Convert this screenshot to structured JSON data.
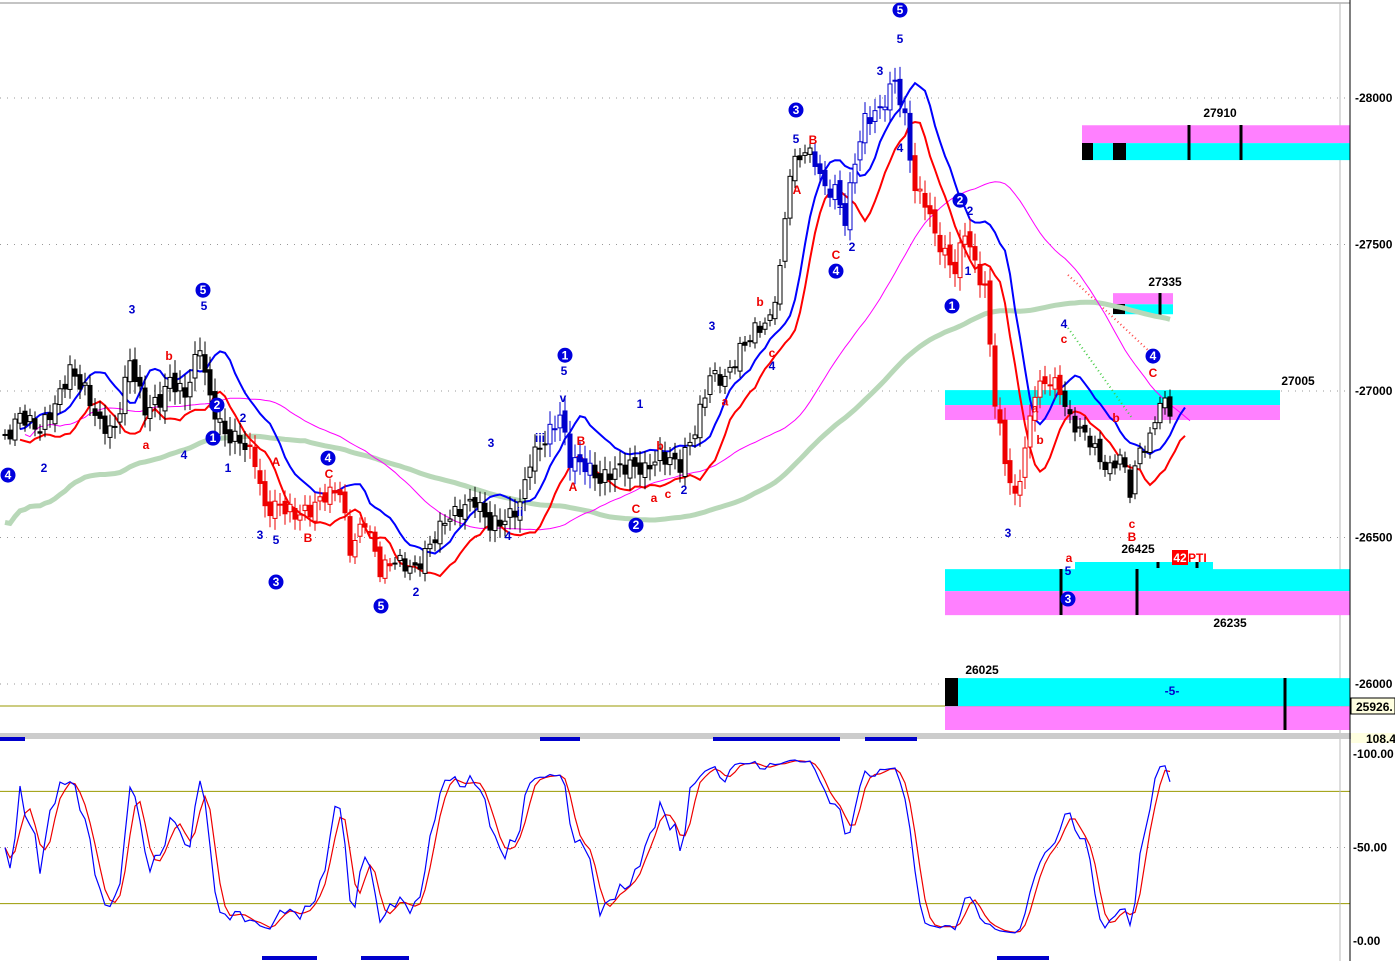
{
  "chart_data": {
    "type": "candlestick",
    "title": "",
    "instrument_note": "Elliott wave annotated price chart with stochastic oscillator",
    "price_axis": {
      "ylim": [
        25843,
        28334
      ],
      "ticks": [
        "28000",
        "27500",
        "27000",
        "26500",
        "26000"
      ],
      "current_tag": "25926."
    },
    "osc_axis": {
      "ylim": [
        0,
        100
      ],
      "ticks": [
        "108.4",
        "100.00",
        "50.00",
        "0.00"
      ],
      "levels": [
        80,
        20
      ]
    },
    "price_path": {
      "bar": [
        1,
        4,
        8,
        11,
        14,
        17,
        20,
        23,
        26,
        29,
        32,
        34,
        37,
        40,
        42,
        45,
        48,
        51,
        53,
        56,
        59,
        62,
        65,
        68,
        70,
        73,
        76,
        79,
        83,
        86,
        89,
        92,
        95,
        98,
        101,
        104,
        106,
        109,
        112,
        114,
        117,
        120,
        123,
        126,
        129,
        132,
        136,
        139,
        142,
        145,
        148,
        151,
        154,
        156,
        158,
        161,
        163,
        165,
        167,
        169,
        171,
        173,
        176,
        179,
        181,
        183,
        185,
        187,
        189,
        191,
        193,
        195,
        197,
        199,
        201,
        203,
        205,
        207,
        210,
        212,
        214,
        216,
        218,
        220,
        222,
        224,
        226,
        228,
        230,
        232,
        234
      ],
      "close": [
        26833,
        26918,
        26867,
        26952,
        27072,
        27003,
        26884,
        26867,
        27106,
        26935,
        26969,
        27038,
        26986,
        27157,
        26969,
        26850,
        26833,
        26764,
        26594,
        26611,
        26577,
        26594,
        26645,
        26662,
        26457,
        26560,
        26389,
        26423,
        26389,
        26474,
        26560,
        26594,
        26628,
        26543,
        26560,
        26611,
        26764,
        26833,
        26918,
        26764,
        26747,
        26696,
        26730,
        26747,
        26730,
        26782,
        26747,
        26867,
        27055,
        27038,
        27140,
        27208,
        27242,
        27413,
        27754,
        27823,
        27788,
        27686,
        27686,
        27584,
        27788,
        27925,
        27959,
        28061,
        27925,
        27686,
        27652,
        27532,
        27464,
        27413,
        27549,
        27430,
        27345,
        26969,
        26764,
        26628,
        26799,
        27003,
        27038,
        27003,
        26901,
        26867,
        26833,
        26764,
        26730,
        26782,
        26662,
        26799,
        26833,
        26969,
        26935
      ]
    },
    "zones": [
      {
        "label": "27910",
        "from_bar": 216.4,
        "to_bar": 270,
        "top": 27907,
        "mid": 27846,
        "bottom": 27788
      },
      {
        "label": "27335",
        "from_bar": 222.6,
        "to_bar": 234.6,
        "top": 27334,
        "mid": 27296,
        "bottom": 27262
      },
      {
        "label": "27005",
        "from_bar": 189,
        "to_bar": 256,
        "top": 27003,
        "mid": 26952,
        "bottom": 26901
      },
      {
        "label": "26425",
        "from_bar": 189,
        "to_bar": 270,
        "top": 26392,
        "mid": 26317,
        "bottom": 26235
      },
      {
        "label": "26235",
        "from_bar": 189,
        "to_bar": 270,
        "top": 26392,
        "mid": 26317,
        "bottom": 26235
      },
      {
        "label": "26025",
        "from_bar": 189,
        "to_bar": 270,
        "top": 26020,
        "mid": 25924,
        "bottom": 25843
      }
    ],
    "zone_text": {
      "center_marker": "-5-",
      "pti_value": "42",
      "pti_label": "PTI"
    },
    "circled_waves": [
      [
        1.6,
        26713,
        "4"
      ],
      [
        40.6,
        27344,
        "5"
      ],
      [
        42.6,
        26839,
        "1"
      ],
      [
        43.4,
        26952,
        "2"
      ],
      [
        55.2,
        26348,
        "3"
      ],
      [
        65.6,
        26771,
        "4"
      ],
      [
        76.2,
        26266,
        "5"
      ],
      [
        113,
        27122,
        "1"
      ],
      [
        127.2,
        26542,
        "2"
      ],
      [
        159.2,
        27959,
        "3"
      ],
      [
        167.2,
        27409,
        "4"
      ],
      [
        180,
        28300,
        "5"
      ],
      [
        190.4,
        27290,
        "1"
      ],
      [
        192,
        27651,
        "2"
      ],
      [
        213.6,
        26290,
        "3"
      ],
      [
        230.6,
        27119,
        "4"
      ]
    ],
    "blue_labels": [
      [
        26.4,
        27279,
        "3"
      ],
      [
        40.8,
        27290,
        "5"
      ],
      [
        36.8,
        26781,
        "4"
      ],
      [
        45.6,
        26737,
        "1"
      ],
      [
        8.8,
        26737,
        "2"
      ],
      [
        48.6,
        26907,
        "2"
      ],
      [
        52,
        26508,
        "3"
      ],
      [
        55.2,
        26491,
        "5"
      ],
      [
        83.2,
        26314,
        "2"
      ],
      [
        98.2,
        26822,
        "3"
      ],
      [
        101.6,
        26505,
        "4"
      ],
      [
        104,
        26587,
        "ii"
      ],
      [
        108,
        26839,
        "iii"
      ],
      [
        112.6,
        26976,
        "v"
      ],
      [
        112.8,
        27068,
        "5"
      ],
      [
        128,
        26955,
        "1"
      ],
      [
        136.8,
        26662,
        "2"
      ],
      [
        142.4,
        27221,
        "3"
      ],
      [
        154.4,
        27085,
        "4"
      ],
      [
        159.2,
        27860,
        "5"
      ],
      [
        168,
        27638,
        "1"
      ],
      [
        170.4,
        27491,
        "2"
      ],
      [
        176,
        28092,
        "3"
      ],
      [
        180,
        28201,
        "5"
      ],
      [
        180,
        27829,
        "4"
      ],
      [
        194,
        27614,
        "2"
      ],
      [
        193.6,
        27409,
        "1"
      ],
      [
        201.6,
        26515,
        "3"
      ],
      [
        212.8,
        27228,
        "4"
      ],
      [
        213.6,
        26385,
        "5"
      ]
    ],
    "red_labels": [
      [
        33.8,
        27119,
        "b"
      ],
      [
        29.2,
        26815,
        "a"
      ],
      [
        55.2,
        26757,
        "A"
      ],
      [
        65.8,
        26716,
        "C"
      ],
      [
        61.6,
        26498,
        "B"
      ],
      [
        116.2,
        26829,
        "B"
      ],
      [
        114.6,
        26672,
        "A"
      ],
      [
        127.2,
        26597,
        "C"
      ],
      [
        130.8,
        26634,
        "a"
      ],
      [
        133.6,
        26648,
        "c"
      ],
      [
        132,
        26812,
        "b"
      ],
      [
        145,
        26965,
        "a"
      ],
      [
        154.4,
        27129,
        "c"
      ],
      [
        152,
        27303,
        "b"
      ],
      [
        159.4,
        27686,
        "A"
      ],
      [
        162.6,
        27856,
        "B"
      ],
      [
        167.2,
        27464,
        "C"
      ],
      [
        207,
        26941,
        "a"
      ],
      [
        208,
        26832,
        "b"
      ],
      [
        212.8,
        27177,
        "c"
      ],
      [
        223.2,
        26907,
        "b"
      ],
      [
        230.6,
        27061,
        "C"
      ],
      [
        226.4,
        26546,
        "c"
      ],
      [
        226.4,
        26501,
        "B"
      ],
      [
        213.8,
        26430,
        "a"
      ]
    ],
    "colors": {
      "up": "#ffffff",
      "down": "#000000",
      "fast_ma": "#0000ff",
      "slow_ma": "#ff0000",
      "ma_mid": "#ff00ff",
      "ma_long": "#b8d8b8",
      "zone_cyan": "#00ffff",
      "zone_pink": "#ff80ff",
      "level_line": "#9a9a00"
    }
  }
}
